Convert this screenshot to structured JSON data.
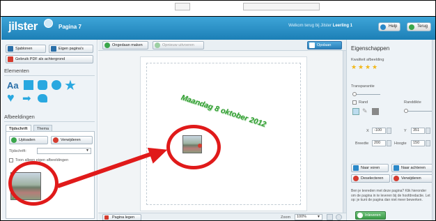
{
  "app": {
    "logo": "jilster",
    "page_title": "Pagina 7",
    "welcome_prefix": "Welkom terug bij Jilster",
    "welcome_name": "Leerling 1",
    "help_label": "Help",
    "back_label": "Terug"
  },
  "left_panel": {
    "sjablonen_label": "Sjablonen",
    "eigen_paginas_label": "Eigen pagina's",
    "pdf_bg_label": "Gebruik PDF als achtergrond",
    "elementen_title": "Elementen",
    "text_tool": "Aa",
    "afbeeldingen_title": "Afbeeldingen",
    "tabs": [
      "Tijdschrift",
      "Thema"
    ],
    "upload_label": "Uploaden",
    "delete_label": "Verwijderen",
    "tijdschrift_label": "Tijdschrift:",
    "show_own_label": "Toon alleen eigen afbeeldingen"
  },
  "toolbar": {
    "undo_label": "Ongedaan maken",
    "redo_label": "Opnieuw uitvoeren",
    "save_label": "Opslaan"
  },
  "canvas": {
    "date_text": "Maandag 8 oktober 2012"
  },
  "bottombar": {
    "clear_page_label": "Pagina legen",
    "zoom_label": "Zoom",
    "zoom_value": "100%"
  },
  "properties": {
    "title": "Eigenschappen",
    "quality_label": "Kwaliteit afbeelding",
    "transparency_label": "Transparantie",
    "border_label": "Rand",
    "border_width_label": "Randdikte",
    "x_label": "X",
    "x_value": "-100",
    "y_label": "Y",
    "y_value": "351",
    "width_label": "Breedte",
    "width_value": "200",
    "height_label": "Hoogte",
    "height_value": "150",
    "front_label": "Naar voren",
    "back_label": "Naar achteren",
    "deselect_label": "Deselecteren",
    "remove_label": "Verwijderen",
    "submit_text": "Ben je tevreden met deze pagina? Klik hieronder om de pagina in te leveren bij de hoofdredactie. Let op: je kunt de pagina dan niet meer bewerken.",
    "submit_label": "Inleveren"
  },
  "colors": {
    "header": "#1c7fb6",
    "accent": "#29a8e0",
    "annotation": "#e01a1a",
    "date_text": "#2e9d2e"
  }
}
